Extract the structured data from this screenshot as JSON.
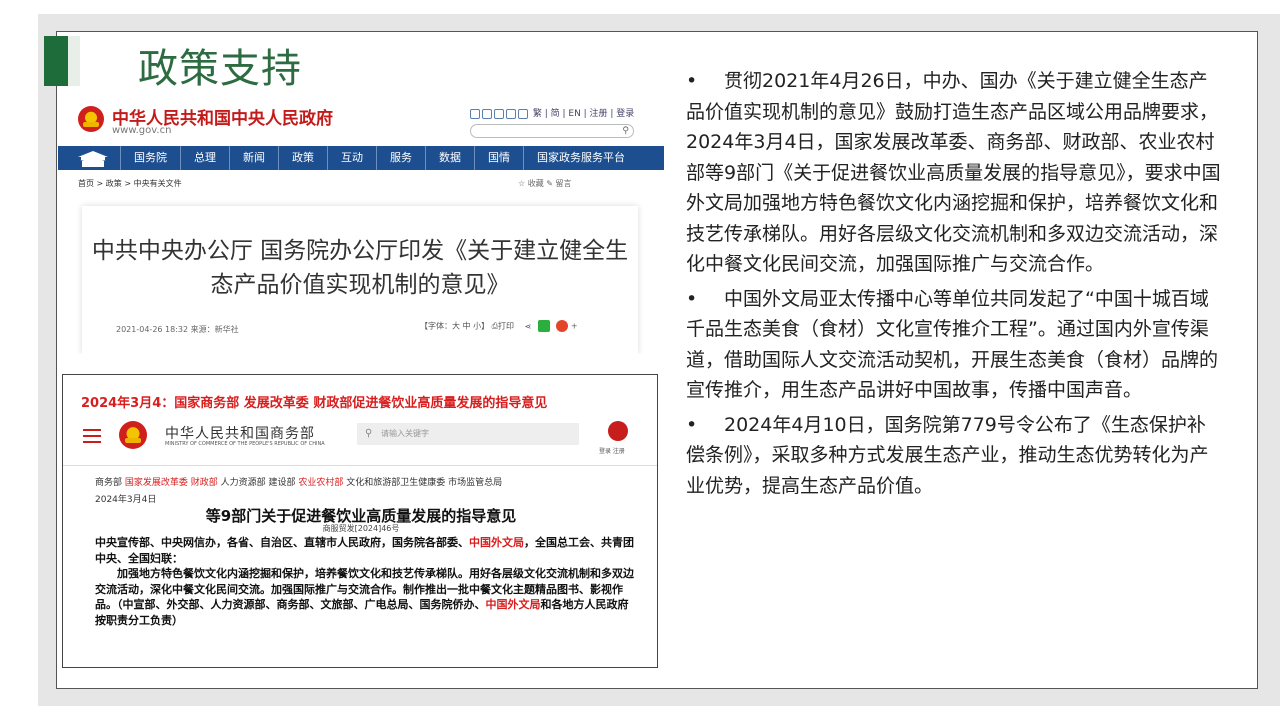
{
  "slide": {
    "title": "政策支持"
  },
  "gov_screenshot": {
    "site_name": "中华人民共和国中央人民政府",
    "url": "www.gov.cn",
    "header_links": "繁 | 简 | EN | 注册 | 登录",
    "nav": [
      "国务院",
      "总理",
      "新闻",
      "政策",
      "互动",
      "服务",
      "数据",
      "国情",
      "国家政务服务平台"
    ],
    "breadcrumb": "首页 > 政策 > 中央有关文件",
    "actions": "☆ 收藏   ✎ 留言",
    "article_title_line1": "中共中央办公厅 国务院办公厅印发《关于建立健全生",
    "article_title_line2": "态产品价值实现机制的意见》",
    "article_meta": "2021-04-26 18:32   来源：新华社",
    "article_tools": "【字体：大 中 小】 ⎙打印"
  },
  "mofcom_screenshot": {
    "headline": "2024年3月4：国家商务部 发展改革委 财政部促进餐饮业高质量发展的指导意见",
    "site_name": "中华人民共和国商务部",
    "site_name_en": "MINISTRY OF COMMERCE OF THE PEOPLE'S REPUBLIC OF CHINA",
    "search_placeholder": "请输入关键字",
    "user_links": "登录  注册",
    "depts_1": "商务部 ",
    "depts_red_1": "国家发展改革委  财政部",
    "depts_2": "  人力资源部 建设部 ",
    "depts_red_2": "农业农村部",
    "depts_3": "  文化和旅游部卫生健康委 市场监管总局",
    "date": "2024年3月4日",
    "doc_title": "等9部门关于促进餐饮业高质量发展的指导意见",
    "doc_no": "商服贸发[2024]46号",
    "body_1": "中央宣传部、中央网信办，各省、自治区、直辖市人民政府，国务院各部委、",
    "body_red_1": "中国外文局",
    "body_2": "，全国总工会、共青团中央、全国妇联：",
    "body_3": "加强地方特色餐饮文化内涵挖掘和保护，培养餐饮文化和技艺传承梯队。用好各层级文化交流机制和多双边交流活动，深化中餐文化民间交流。加强国际推广与交流合作。制作推出一批中餐文化主题精品图书、影视作品。（中宣部、外交部、人力资源部、商务部、文旅部、广电总局、国务院侨办、",
    "body_red_2": "中国外文局",
    "body_4": "和各地方人民政府按职责分工负责）"
  },
  "bullets": [
    {
      "marker": "•",
      "text": "贯彻2021年4月26日，中办、国办《关于建立健全生态产品价值实现机制的意见》鼓励打造生态产品区域公用品牌要求，2024年3月4日，国家发展改革委、商务部、财政部、农业农村部等9部门《关于促进餐饮业高质量发展的指导意见》，要求中国外文局加强地方特色餐饮文化内涵挖掘和保护，培养餐饮文化和技艺传承梯队。用好各层级文化交流机制和多双边交流活动，深化中餐文化民间交流，加强国际推广与交流合作。"
    },
    {
      "marker": "•",
      "text": "中国外文局亚太传播中心等单位共同发起了“中国十城百域千品生态美食（食材）文化宣传推介工程”。通过国内外宣传渠道，借助国际人文交流活动契机，开展生态美食（食材）品牌的宣传推介，用生态产品讲好中国故事，传播中国声音。"
    },
    {
      "marker": "•",
      "text": "2024年4月10日，国务院第779号令公布了《生态保护补偿条例》，采取多种方式发展生态产业，推动生态优势转化为产业优势，提高生态产品价值。"
    }
  ]
}
